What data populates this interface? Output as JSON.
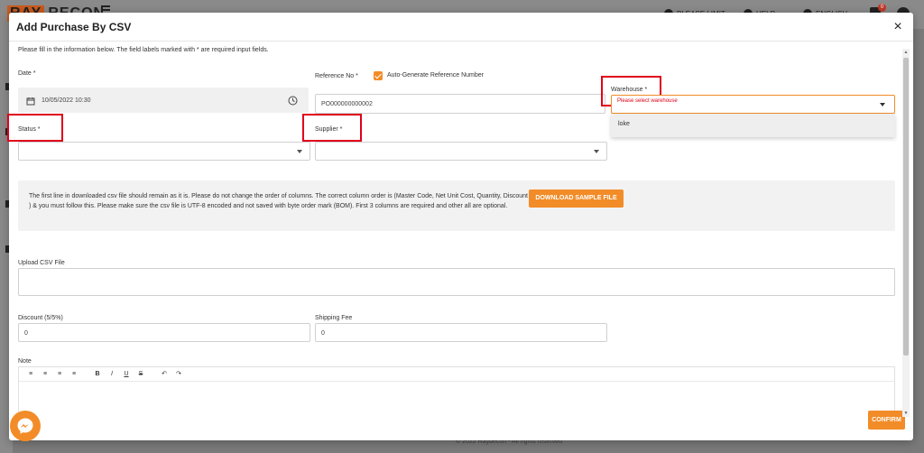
{
  "background": {
    "logo_box": "RAY",
    "logo_text": "RECON",
    "nav_items": [
      "PLEASE LIMIT",
      "HELP",
      "ENGLISH"
    ],
    "cart_badge": "0",
    "footer": "© 2022 Raybecon - All rights reserved"
  },
  "modal": {
    "title": "Add Purchase By CSV",
    "close_label": "×",
    "intro": "Please fill in the information below. The field labels marked with * are required input fields.",
    "date": {
      "label": "Date *",
      "value": "10/05/2022 10:30"
    },
    "reference": {
      "label": "Reference No *",
      "checkbox_label": "Auto-Generate Reference Number",
      "value": "PO000000000002"
    },
    "warehouse": {
      "label": "Warehouse *",
      "placeholder": "Please select warehouse",
      "options": [
        "loke"
      ]
    },
    "status": {
      "label": "Status *",
      "value": ""
    },
    "supplier": {
      "label": "Supplier *",
      "value": ""
    },
    "info_text": "The first line in downloaded csv file should remain as it is. Please do not change the order of columns. The correct column order is (Master Code, Net Unit Cost, Quantity, Discount ) & you must follow this. Please make sure the csv file is UTF-8 encoded and not saved with byte order mark (BOM). First 3 columns are required and other all are optional.",
    "download_button": "DOWNLOAD SAMPLE FILE",
    "upload": {
      "label": "Upload CSV File"
    },
    "discount": {
      "label": "Discount (5/5%)",
      "value": "0"
    },
    "shipping": {
      "label": "Shipping Fee",
      "value": "0"
    },
    "note": {
      "label": "Note",
      "toolbar": [
        "≡",
        "≡",
        "≡",
        "≡",
        "B",
        "I",
        "U",
        "S",
        "↶",
        "↷"
      ]
    },
    "confirm_button": "CONFIRM"
  },
  "colors": {
    "accent": "#f28c28",
    "highlight": "#e0001a"
  }
}
